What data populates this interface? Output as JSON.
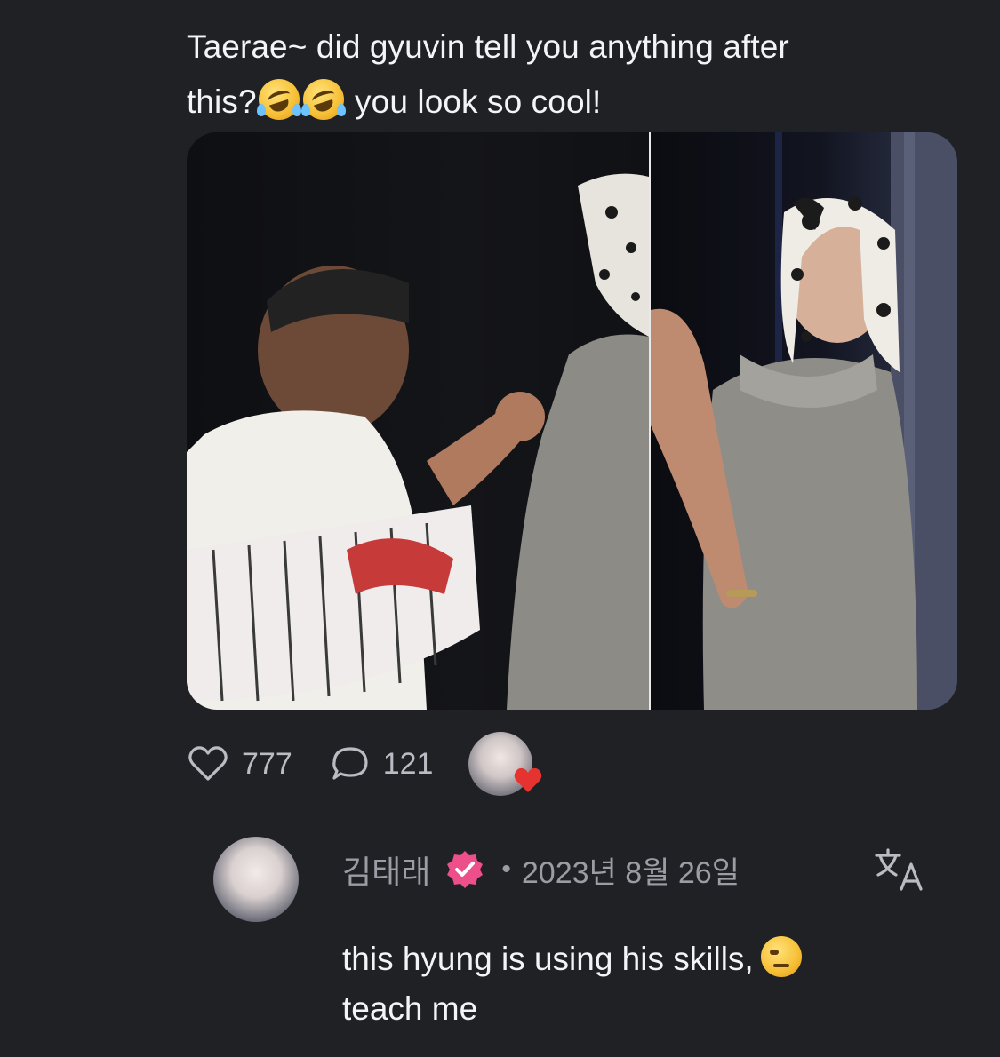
{
  "post": {
    "text_line1": "Taerae~ did gyuvin tell you anything after",
    "text_line2_a": "this?",
    "text_line2_b": " you look so cool!",
    "emoji_name": "rolling-on-floor-laughing-emoji",
    "likes": "777",
    "comments": "121"
  },
  "reply": {
    "author": "김태래",
    "timestamp": "2023년 8월 26일",
    "separator": "•",
    "text_line1": "this hyung is using his skills,",
    "text_line2": "teach me",
    "emoji_name": "face-with-raised-eyebrow-emoji"
  },
  "icons": {
    "like": "heart-outline-icon",
    "comment": "speech-bubble-icon",
    "verified": "verified-badge-icon",
    "translate": "translate-icon",
    "liked_heart": "red-heart-icon"
  },
  "colors": {
    "background": "#1f2125",
    "text": "#f4f4f6",
    "muted": "#9a9da4",
    "verified_badge": "#ec4f8a",
    "heart": "#e6332f"
  }
}
